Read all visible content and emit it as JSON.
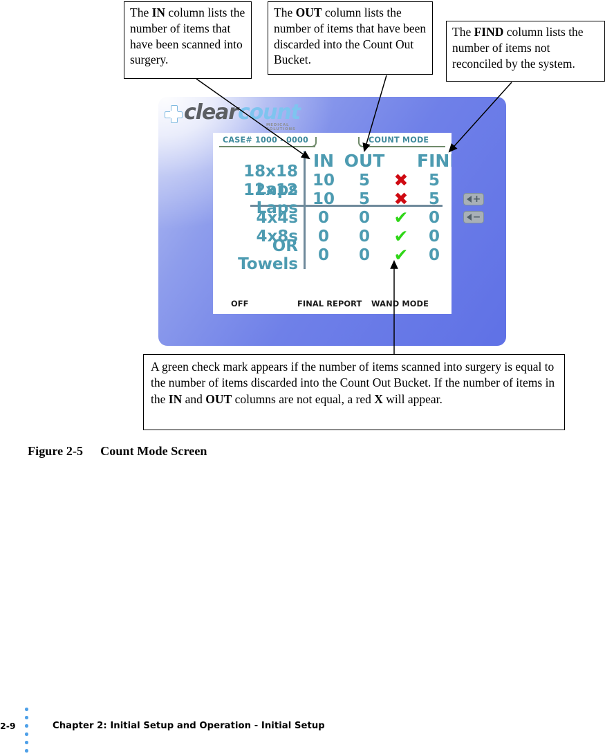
{
  "callouts": {
    "in": {
      "id": "callout-in",
      "text_before": "The ",
      "bold": "IN",
      "text_after": " column lists the number of items that have been scanned into surgery."
    },
    "out": {
      "id": "callout-out",
      "text_before": "The ",
      "bold": "OUT",
      "text_after": " column lists the number of items that have been discarded into the Count Out Bucket."
    },
    "find": {
      "id": "callout-find",
      "text_before": "The ",
      "bold": "FIND",
      "text_after": " column lists the number of items not reconciled by the system."
    },
    "check": {
      "seg1": "A green check mark appears if the number of items scanned into surgery is equal to the number of items discarded into the Count Out Bucket. If the number of items in the ",
      "bold1": "IN",
      "seg2": " and ",
      "bold2": "OUT",
      "seg3": " columns are not equal, a red ",
      "bold3": "X",
      "seg4": " will appear."
    }
  },
  "device": {
    "logo": {
      "word_a": "clear",
      "word_b": "count",
      "tagline": "MEDICAL SOLUTIONS",
      "cross_icon": "medical-cross-icon"
    },
    "screen": {
      "case_tab": "CASE# 1000 - 0000",
      "mode_tab": "COUNT MODE",
      "table": {
        "headers": [
          "",
          "IN",
          "OUT",
          "",
          "FIND"
        ],
        "rows": [
          {
            "name": "18x18 Laps",
            "in": "10",
            "out": "5",
            "flag": "x",
            "find": "5"
          },
          {
            "name": "12x12 Laps",
            "in": "10",
            "out": "5",
            "flag": "x",
            "find": "5"
          },
          {
            "name": "4x4s",
            "in": "0",
            "out": "0",
            "flag": "check",
            "find": "0"
          },
          {
            "name": "4x8s",
            "in": "0",
            "out": "0",
            "flag": "check",
            "find": "0"
          },
          {
            "name": "OR Towels",
            "in": "0",
            "out": "0",
            "flag": "check",
            "find": "0"
          }
        ],
        "flag_glyphs": {
          "x": "✖",
          "check": "✔"
        },
        "flag_colors": {
          "x": "#cf0a12",
          "check": "#2fd617"
        }
      },
      "softkeys": [
        "OFF",
        "FINAL REPORT",
        "WAND MODE"
      ]
    },
    "volume": {
      "up_label": "+",
      "down_label": "−"
    },
    "colors": {
      "bezel_blue": "#6f80e8",
      "screen_text": "#4d9bb1",
      "tab_text": "#3f8a9c",
      "tab_rule": "#6f8a6a"
    }
  },
  "caption": {
    "number": "Figure 2-5",
    "title": "Count Mode Screen"
  },
  "footer": {
    "page": "2-9",
    "text": "Chapter 2: Initial Setup and Operation - Initial Setup",
    "dot_count": 6,
    "dot_color": "#4ea0e8"
  }
}
